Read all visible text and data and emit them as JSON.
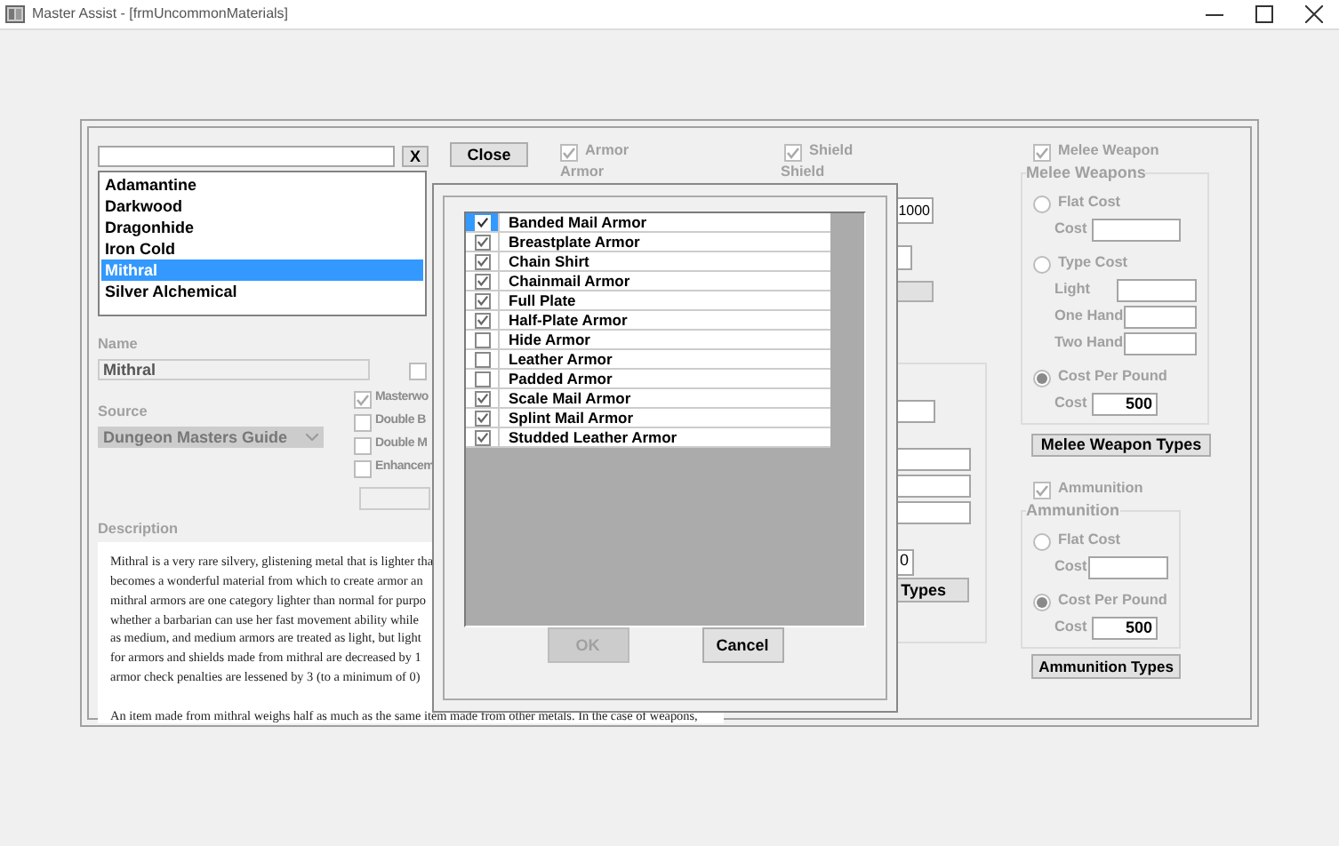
{
  "window": {
    "title": "Master Assist - [frmUncommonMaterials]"
  },
  "materials": {
    "clear_button": "X",
    "items": [
      {
        "label": "Adamantine",
        "selected": false
      },
      {
        "label": "Darkwood",
        "selected": false
      },
      {
        "label": "Dragonhide",
        "selected": false
      },
      {
        "label": "Iron Cold",
        "selected": false
      },
      {
        "label": "Mithral",
        "selected": true
      },
      {
        "label": "Silver Alchemical",
        "selected": false
      }
    ]
  },
  "name": {
    "label": "Name",
    "value": "Mithral"
  },
  "extra_checkbox": {
    "checked": false
  },
  "source": {
    "label": "Source",
    "value": "Dungeon Masters Guide"
  },
  "options": [
    {
      "label": "Masterwo",
      "checked": true
    },
    {
      "label": "Double B",
      "checked": false
    },
    {
      "label": "Double M",
      "checked": false
    },
    {
      "label": "Enhancem",
      "checked": false
    }
  ],
  "description": {
    "label": "Description",
    "lines": [
      "Mithral is a very rare silvery, glistening metal that is lighter tha",
      "becomes a wonderful material from which to create armor an",
      "mithral armors are one category lighter than normal for purpo",
      "whether a barbarian can use her fast movement ability while",
      "as medium, and medium armors are treated as light, but light",
      "for armors and shields made from mithral are decreased by 1",
      "armor check penalties are lessened by 3 (to a minimum of 0)"
    ],
    "paragraph_2": "An item made from mithral weighs half as much as the same item made from other metals. In the case of weapons,"
  },
  "close_button": "Close",
  "armor": {
    "label": "Armor",
    "checked": true,
    "group_label": "Armor"
  },
  "shield": {
    "label": "Shield",
    "checked": true,
    "group_label": "Shield",
    "cost": "1000",
    "second_cost": "0",
    "types_button": "Types"
  },
  "melee": {
    "label": "Melee Weapon",
    "checked": true,
    "group_label": "Melee Weapons",
    "choices": [
      {
        "label": "Flat Cost",
        "selected": false,
        "fields": [
          {
            "label": "Cost"
          }
        ]
      },
      {
        "label": "Type Cost",
        "selected": false,
        "fields": [
          {
            "label": "Light"
          },
          {
            "label": "One Hand"
          },
          {
            "label": "Two Hand"
          }
        ]
      },
      {
        "label": "Cost Per Pound",
        "selected": true,
        "fields": [
          {
            "label": "Cost",
            "value": "500"
          }
        ]
      }
    ],
    "types_button": "Melee Weapon Types"
  },
  "ammunition": {
    "label": "Ammunition",
    "checked": true,
    "group_label": "Ammunition",
    "choices": [
      {
        "label": "Flat Cost",
        "selected": false,
        "fields": [
          {
            "label": "Cost"
          }
        ]
      },
      {
        "label": "Cost Per Pound",
        "selected": true,
        "fields": [
          {
            "label": "Cost",
            "value": "500"
          }
        ]
      }
    ],
    "types_button": "Ammunition Types"
  },
  "dialog": {
    "items": [
      {
        "label": "Banded Mail Armor",
        "checked": true,
        "selected": true
      },
      {
        "label": "Breastplate Armor",
        "checked": true,
        "selected": false
      },
      {
        "label": "Chain Shirt",
        "checked": true,
        "selected": false
      },
      {
        "label": "Chainmail Armor",
        "checked": true,
        "selected": false
      },
      {
        "label": "Full Plate",
        "checked": true,
        "selected": false
      },
      {
        "label": "Half-Plate Armor",
        "checked": true,
        "selected": false
      },
      {
        "label": "Hide Armor",
        "checked": false,
        "selected": false
      },
      {
        "label": "Leather Armor",
        "checked": false,
        "selected": false
      },
      {
        "label": "Padded Armor",
        "checked": false,
        "selected": false
      },
      {
        "label": "Scale Mail Armor",
        "checked": true,
        "selected": false
      },
      {
        "label": "Splint Mail Armor",
        "checked": true,
        "selected": false
      },
      {
        "label": "Studded Leather Armor",
        "checked": true,
        "selected": false
      }
    ],
    "ok": {
      "label": "OK",
      "disabled": true
    },
    "cancel": {
      "label": "Cancel",
      "disabled": false
    }
  }
}
